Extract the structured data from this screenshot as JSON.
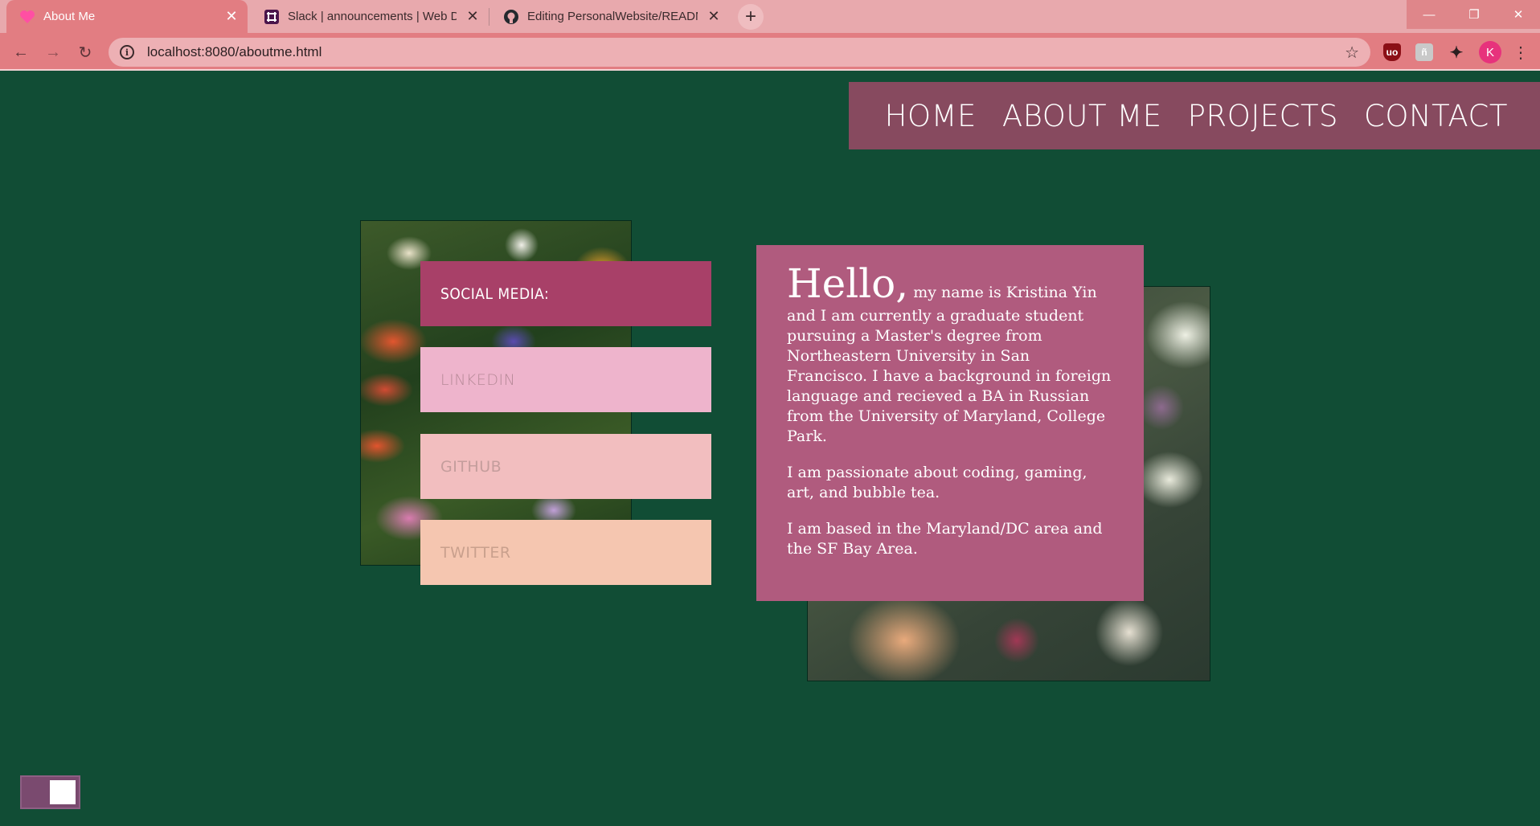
{
  "browser": {
    "tabs": [
      {
        "title": "About Me",
        "icon": "heart-icon",
        "active": true
      },
      {
        "title": "Slack | announcements | Web De",
        "icon": "slack-icon",
        "active": false
      },
      {
        "title": "Editing PersonalWebsite/READM",
        "icon": "github-icon",
        "active": false
      }
    ],
    "new_tab_label": "+",
    "url": "localhost:8080/aboutme.html",
    "profile_initial": "K",
    "ext_ublock": "uo",
    "ext_grammar": "ñ"
  },
  "nav": {
    "items": [
      "HOME",
      "ABOUT ME",
      "PROJECTS",
      "CONTACT"
    ]
  },
  "social": {
    "heading": "SOCIAL MEDIA:",
    "links": [
      "LINKEDIN",
      "GITHUB",
      "TWITTER"
    ]
  },
  "about": {
    "greeting": "Hello,",
    "intro": " my name is Kristina Yin and I am currently a graduate student pursuing a Master's degree from Northeastern University in San Francisco. I have a background in foreign language and recieved a BA in Russian from the University of Maryland, College Park.",
    "passions": "I am passionate about coding, gaming, art, and bubble tea.",
    "location": "I am based in the Maryland/DC area and the SF Bay Area."
  },
  "colors": {
    "page_bg": "#114d35",
    "nav_bg": "#874a5f",
    "card_bg": "#b05b7e",
    "social_head": "#a84068",
    "linkedin_bg": "#eeb4cc",
    "github_bg": "#f2bebf",
    "twitter_bg": "#f5c6b0"
  }
}
